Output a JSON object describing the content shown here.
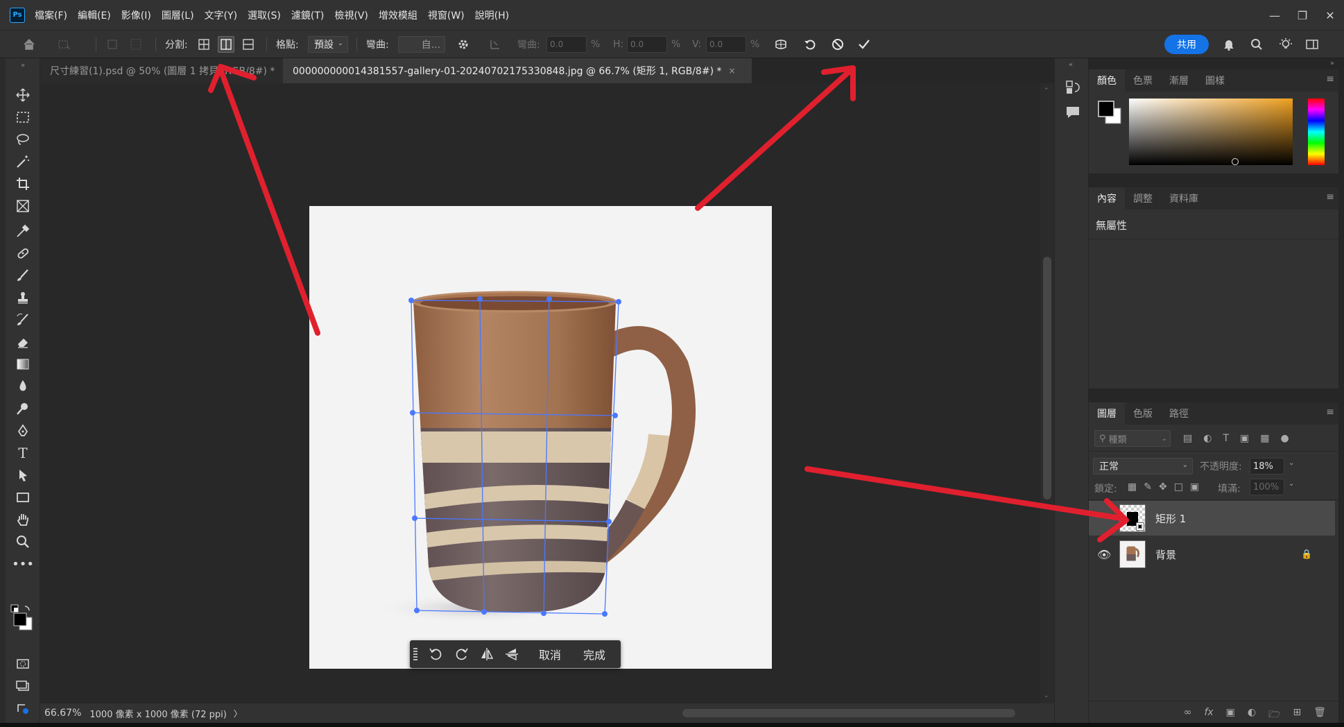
{
  "menu": {
    "logo": "Ps",
    "items": [
      "檔案(F)",
      "編輯(E)",
      "影像(I)",
      "圖層(L)",
      "文字(Y)",
      "選取(S)",
      "濾鏡(T)",
      "檢視(V)",
      "增效模組",
      "視窗(W)",
      "說明(H)"
    ],
    "window_controls": [
      "minimize",
      "restore",
      "close"
    ]
  },
  "options": {
    "split_label": "分割:",
    "grid_label": "格點:",
    "grid_value": "預設",
    "warp_label": "彎曲:",
    "warp_value": "自...",
    "bend_label": "彎曲:",
    "bend_value": "0.0",
    "h_label": "H:",
    "h_value": "0.0",
    "v_label": "V:",
    "v_value": "0.0",
    "percent": "%",
    "share": "共用"
  },
  "tabs": [
    {
      "title": "尺寸練習(1).psd @ 50% (圖層 1 拷貝, RGB/8#) *",
      "close": "×"
    },
    {
      "title": "000000000014381557-gallery-01-20240702175330848.jpg @ 66.7% (矩形 1, RGB/8#) *",
      "close": "×"
    }
  ],
  "transform_bar": {
    "cancel": "取消",
    "done": "完成"
  },
  "status": {
    "zoom": "66.67%",
    "doc_info": "1000 像素 x 1000 像素 (72 ppi)",
    "arrow": "〉"
  },
  "color_panel": {
    "tabs": [
      "顏色",
      "色票",
      "漸層",
      "圖樣"
    ]
  },
  "properties_panel": {
    "tabs": [
      "內容",
      "調整",
      "資料庫"
    ],
    "empty_text": "無屬性"
  },
  "layers_panel": {
    "tabs": [
      "圖層",
      "色版",
      "路徑"
    ],
    "search_placeholder": "種類",
    "blend_mode": "正常",
    "opacity_label": "不透明度:",
    "opacity_value": "18%",
    "lock_label": "鎖定:",
    "fill_label": "填滿:",
    "fill_value": "100%",
    "layers": [
      {
        "name": "矩形 1",
        "selected": true,
        "visible": false
      },
      {
        "name": "背景",
        "selected": false,
        "visible": true,
        "locked": true
      }
    ]
  },
  "colors": {
    "accent_blue": "#1473e6",
    "annotation_red": "#e0202e",
    "warp_grid": "#4a78ff"
  }
}
